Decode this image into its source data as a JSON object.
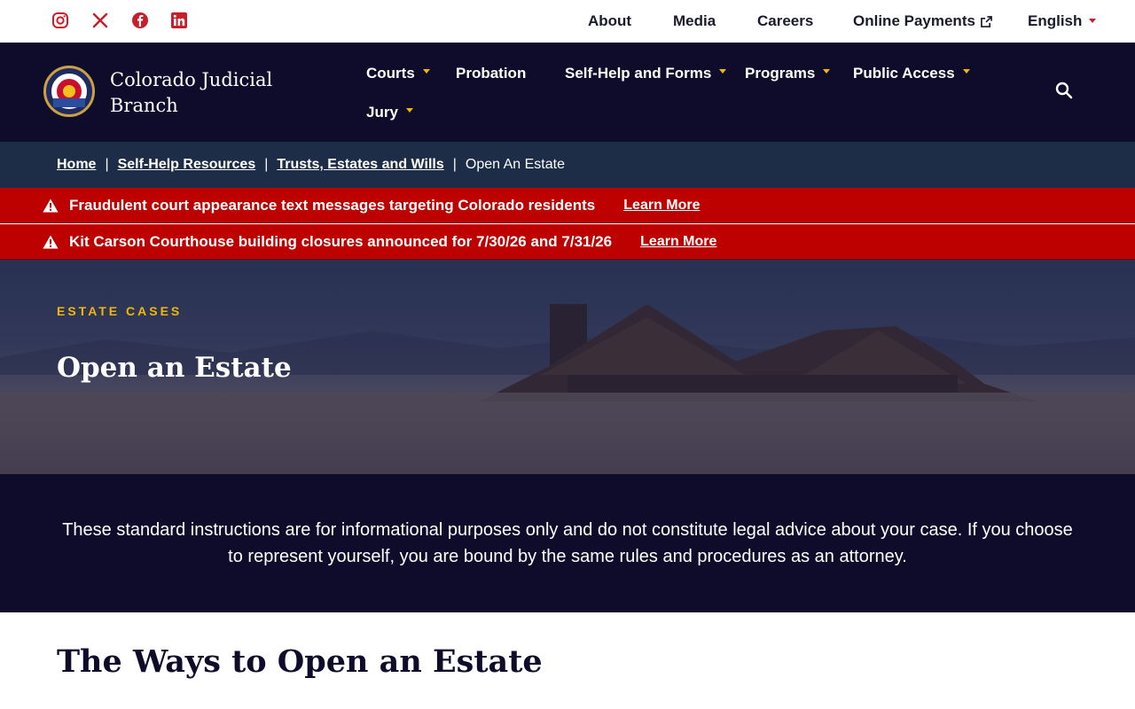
{
  "utility": {
    "social": [
      "instagram-icon",
      "x-twitter-icon",
      "facebook-icon",
      "linkedin-icon"
    ],
    "links": {
      "about": "About",
      "media": "Media",
      "careers": "Careers",
      "payments": "Online Payments",
      "language": "English"
    }
  },
  "brand": {
    "name": "Colorado Judicial Branch",
    "seal_text": "COLORADO COURTS"
  },
  "nav": {
    "courts": "Courts",
    "probation": "Probation",
    "self_help": "Self-Help and Forms",
    "programs": "Programs",
    "public_access": "Public Access",
    "jury": "Jury"
  },
  "breadcrumb": {
    "home": "Home",
    "self_help": "Self-Help Resources",
    "trusts": "Trusts, Estates and Wills",
    "current": "Open An Estate"
  },
  "alerts": [
    {
      "message": "Fraudulent court appearance text messages targeting Colorado residents",
      "link": "Learn More"
    },
    {
      "message": "Kit Carson Courthouse building closures announced for 7/30/26 and 7/31/26",
      "link": "Learn More"
    }
  ],
  "hero": {
    "eyebrow": "ESTATE CASES",
    "title": "Open an Estate"
  },
  "disclaimer": "These standard instructions are for informational purposes only and do not constitute legal advice about your case. If you choose to represent yourself, you are bound by the same rules and procedures as an attorney.",
  "section": {
    "title": "The Ways to Open an Estate"
  },
  "colors": {
    "navy": "#0e0b2b",
    "breadcrumb_bg": "#1d2d47",
    "alert_red": "#bd0000",
    "accent_gold": "#f2b705",
    "social_red": "#c81e2a"
  }
}
